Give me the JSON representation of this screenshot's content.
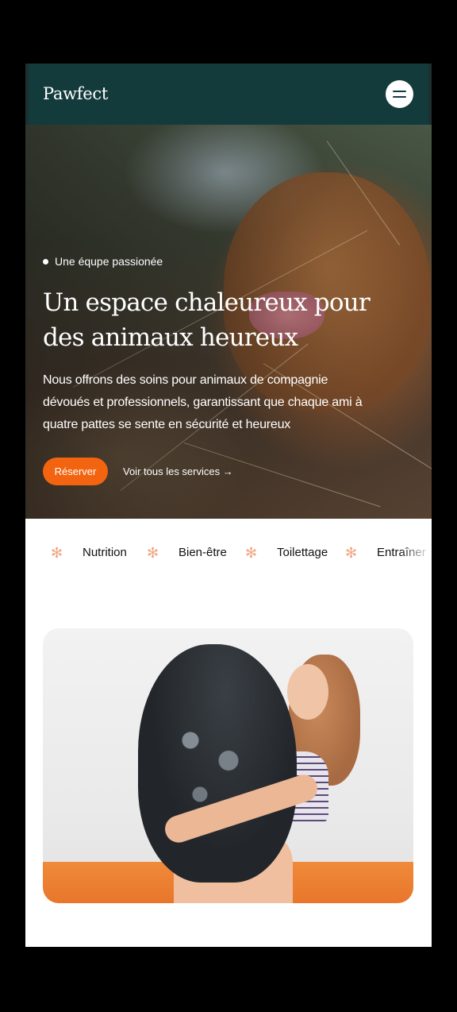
{
  "header": {
    "logo": "Pawfect",
    "menu_icon": "hamburger-menu-icon",
    "background": "#143b3b"
  },
  "hero": {
    "tagline": "Une équpe passionée",
    "title": "Un espace chaleureux pour des animaux heureux",
    "description": "Nous offrons des soins pour animaux de compagnie dévoués et professionnels, garantissant que chaque ami à quatre pattes se sente en sécurité et heureux",
    "primary_button": "Réserver",
    "secondary_link": "Voir tous les services →",
    "accent_color": "#f2640f"
  },
  "marquee": {
    "items": [
      "Nutrition",
      "Bien-être",
      "Toilettage",
      "Entraîner"
    ],
    "separator_icon": "asterisk-flower-icon",
    "separator_color": "#f0a886"
  },
  "photo": {
    "subject": "girl-hugging-dog-photo"
  }
}
